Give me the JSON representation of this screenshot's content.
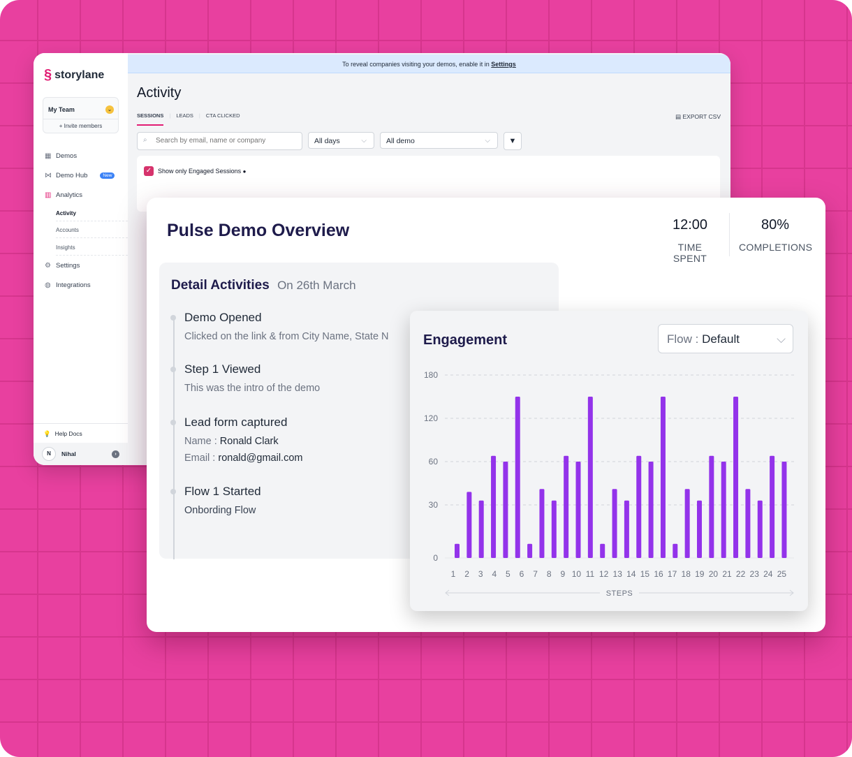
{
  "brand": {
    "name": "storylane",
    "accent": "#e11d74",
    "bg": "#e8409f"
  },
  "sidebar": {
    "team": "My Team",
    "invite": "+ Invite members",
    "items": [
      {
        "label": "Demos"
      },
      {
        "label": "Demo Hub",
        "badge": "New"
      },
      {
        "label": "Analytics"
      },
      {
        "label": "Settings"
      },
      {
        "label": "Integrations"
      }
    ],
    "analytics_sub": [
      "Activity",
      "Accounts",
      "Insights"
    ],
    "help": "Help Docs",
    "user": "Nihal"
  },
  "banner": {
    "text": "To reveal companies visiting your demos, enable it in",
    "link": "Settings"
  },
  "activity": {
    "title": "Activity",
    "tabs": [
      "SESSIONS",
      "LEADS",
      "CTA CLICKED"
    ],
    "export": "EXPORT CSV",
    "search_placeholder": "Search by email, name or company",
    "days": "All days",
    "demo": "All demo",
    "engaged_label": "Show only Engaged Sessions"
  },
  "overview": {
    "title": "Pulse Demo Overview",
    "time_value": "12:00",
    "time_label": "TIME SPENT",
    "completion_value": "80%",
    "completion_label": "COMPLETIONS"
  },
  "details": {
    "title": "Detail Activities",
    "date": "On 26th March",
    "events": [
      {
        "title": "Demo Opened",
        "desc": "Clicked on the link & from City Name, State N"
      },
      {
        "title": "Step 1 Viewed",
        "desc": "This was the intro of the demo"
      },
      {
        "title": "Lead form captured",
        "name_label": "Name :",
        "name": "Ronald Clark",
        "email_label": "Email :",
        "email": "ronald@gmail.com"
      },
      {
        "title": "Flow 1 Started",
        "desc": "Onbording  Flow"
      }
    ]
  },
  "engagement": {
    "title": "Engagement",
    "flow_label": "Flow :",
    "flow_value": "Default"
  },
  "chart_data": {
    "type": "bar",
    "title": "Engagement",
    "xlabel": "STEPS",
    "ylabel": "",
    "yticks": [
      "180",
      "120",
      "60",
      "30",
      "0"
    ],
    "categories": [
      "1",
      "2",
      "3",
      "4",
      "5",
      "6",
      "7",
      "8",
      "9",
      "10",
      "11",
      "12",
      "13",
      "14",
      "15",
      "16",
      "17",
      "18",
      "19",
      "20",
      "21",
      "22",
      "23",
      "24",
      "25"
    ],
    "values": [
      8,
      39,
      33,
      68,
      60,
      150,
      8,
      41,
      33,
      68,
      60,
      150,
      8,
      41,
      33,
      68,
      60,
      150,
      8,
      41,
      33,
      68,
      60,
      150,
      41,
      33,
      68,
      60
    ],
    "color": "#9333ea",
    "grid": true
  }
}
